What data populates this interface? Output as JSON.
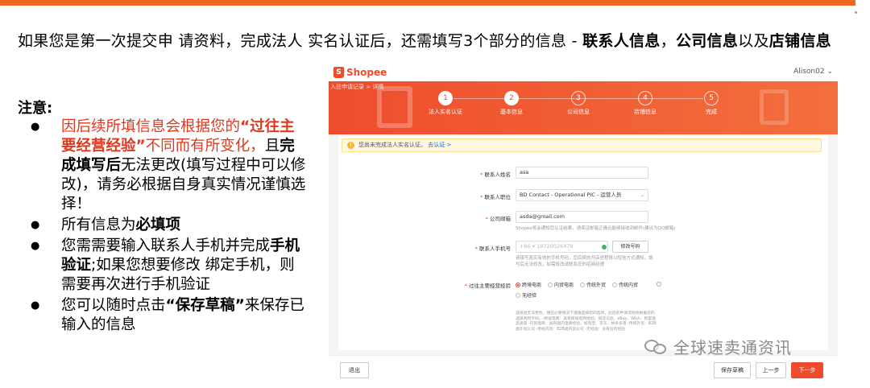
{
  "headline": {
    "plain_1": "如果您是第一次提交申 请资料，完成法人 实名认证后，还需填写3个部分的信息 - ",
    "bold_1": "联系人信息",
    "sep_1": "，",
    "bold_2": "公司信息",
    "sep_2": "以及",
    "bold_3": "店铺信息"
  },
  "notes": {
    "title": "注意:",
    "n1_red_1": "因后续所填信息会根据您的",
    "n1_bold_red": "“过往主要经营经验”",
    "n1_red_2": "不同而有所变化，",
    "n1_plain_1": "且",
    "n1_bold": "完成填写后",
    "n1_plain_2": "无法更改(填写过程中可以修改)，请务必根据自身真实情况谨慎选择！",
    "n2_plain": "所有信息为",
    "n2_bold": "必填项",
    "n3_plain_1": "您需需要输入联系人手机并完成",
    "n3_bold": "手机验证",
    "n3_plain_2": ";如果您想要修改 绑定手机，则需要再次进行手机验证",
    "n4_plain_1": "您可以随时点击",
    "n4_bold": "“保存草稿”",
    "n4_plain_2": "来保存已输入的信息"
  },
  "shot": {
    "logo_letter": "S",
    "logo_text": "Shopee",
    "user": "Alison02 ⌄",
    "breadcrumb": "入驻申请记录 > 详情",
    "steps": [
      {
        "num": "1",
        "label": "法人实名认证"
      },
      {
        "num": "2",
        "label": "基本信息"
      },
      {
        "num": "3",
        "label": "公司信息"
      },
      {
        "num": "4",
        "label": "店铺信息"
      },
      {
        "num": "5",
        "label": "完成"
      }
    ],
    "alert_text": "您尚未完成法人实名认证。",
    "alert_link": "去认证 >",
    "fields": {
      "name_label": "联系人姓名",
      "name_value": "asa",
      "position_label": "联系人职位",
      "position_value": "BD Contact - Operational PIC - 运营人员",
      "email_label": "公司邮箱",
      "email_value": "asda@gmail.com",
      "email_hint": "Shopee将会通知您认证结果，请保证邮箱正确且能够接收到邮件(建议为QQ邮箱)",
      "phone_label": "联系人手机号",
      "phone_value": "+86  ▾  18720026478",
      "phone_button": "修改号码",
      "phone_hint": "请填写真实有效的手机号码，您后续的开店进程将以短信方式通知，填写后无法修改，如需修改请联系您的招商经理",
      "exp_label": "过往主要经营经验",
      "exp_options": [
        "跨境电商",
        "内贸电商",
        "传统外贸",
        "传统内贸",
        "无经验"
      ],
      "exp_desc": "选择后无法更改，请在必要情况下谨慎选择您的选项，此后的申请流程将根据您的选择有所不同。-跨境电商：具有跨境电商经验，如亚马逊、eBay、Wish、阿里速卖通等 -内贸电商：具有国内电商经验，如淘宝、京东、拼多多等 -传统外贸：B2B类外贸公司 -传统内贸：B2B类内贸公司 -无经验：没有任何经验"
    },
    "footer": {
      "exit": "退出",
      "save_draft": "保存草稿",
      "prev": "上一步",
      "next": "下一步"
    }
  },
  "watermark": "全球速卖通资讯"
}
